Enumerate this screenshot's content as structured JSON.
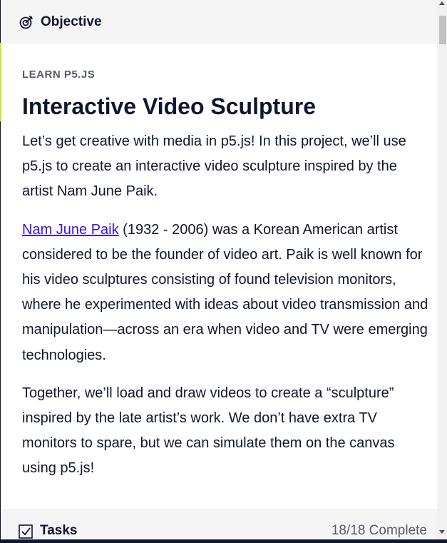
{
  "header": {
    "title": "Objective",
    "icon": "target-icon"
  },
  "lesson": {
    "eyebrow": "LEARN P5.JS",
    "title": "Interactive Video Sculpture",
    "paragraph1": "Let’s get creative with media in p5.js! In this project, we’ll use p5.js to create an interactive video sculpture inspired by the artist Nam June Paik.",
    "paragraph2_link": "Nam June Paik",
    "paragraph2_rest": " (1932 - 2006) was a Korean American artist considered to be the founder of video art. Paik is well known for his video sculptures consisting of found television monitors, where he experimented with ideas about video transmission and manipulation—across an era when video and TV were emerging technologies.",
    "paragraph3": "Together, we’ll load and draw videos to create a “sculpture” inspired by the late artist’s work. We don’t have extra TV monitors to spare, but we can simulate them on the canvas using p5.js!"
  },
  "tasks": {
    "label": "Tasks",
    "count": "18/18 Complete",
    "icon": "checkbox-icon"
  },
  "colors": {
    "text": "#10162f",
    "link": "#3a10e5",
    "muted": "#545d6b",
    "panel": "#f5f5f5",
    "accent": "#c6e82a"
  }
}
